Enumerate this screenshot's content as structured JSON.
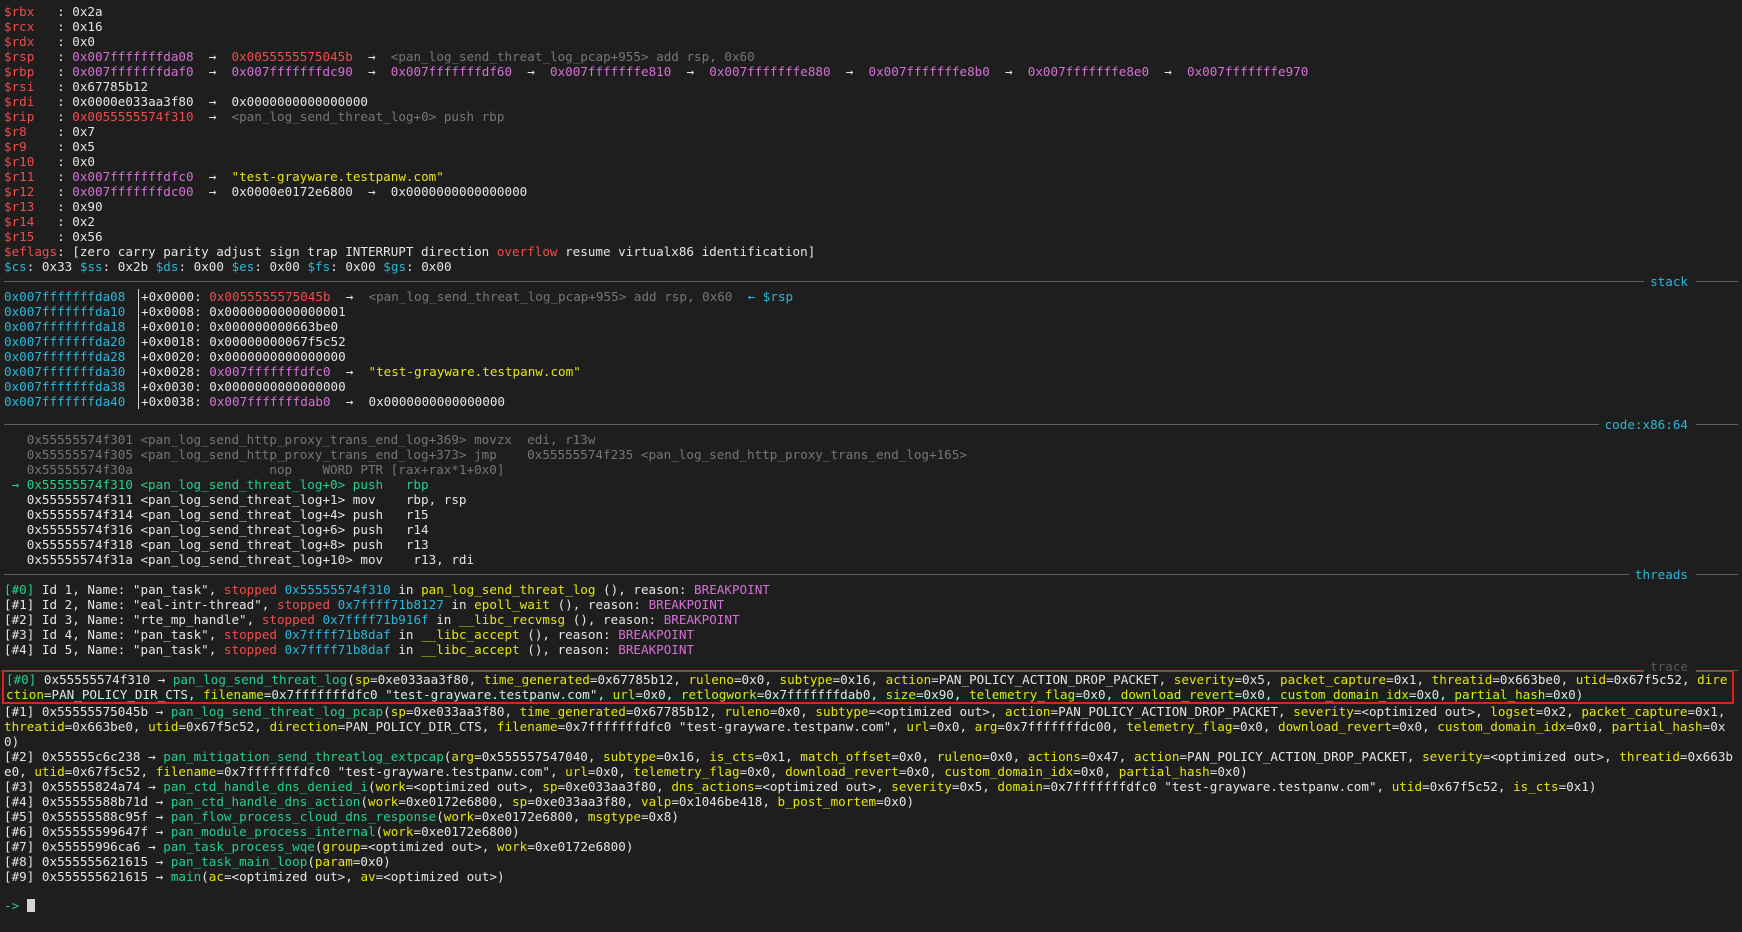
{
  "registers": [
    {
      "name": "$rbx",
      "pad": "   ",
      "parts": [
        [
          "wht",
          "0x2a"
        ]
      ]
    },
    {
      "name": "$rcx",
      "pad": "   ",
      "parts": [
        [
          "wht",
          "0x16"
        ]
      ]
    },
    {
      "name": "$rdx",
      "pad": "   ",
      "parts": [
        [
          "wht",
          "0x0"
        ]
      ]
    },
    {
      "name": "$rsp",
      "pad": "   ",
      "parts": [
        [
          "mag",
          "0x007fffffffda08"
        ],
        [
          "wht",
          "  →  "
        ],
        [
          "red",
          "0x0055555575045b"
        ],
        [
          "wht",
          "  →  "
        ],
        [
          "gry",
          "<pan_log_send_threat_log_pcap+955> add rsp, 0x60"
        ]
      ]
    },
    {
      "name": "$rbp",
      "pad": "   ",
      "parts": [
        [
          "mag",
          "0x007fffffffdaf0"
        ],
        [
          "wht",
          "  →  "
        ],
        [
          "mag",
          "0x007fffffffdc90"
        ],
        [
          "wht",
          "  →  "
        ],
        [
          "mag",
          "0x007fffffffdf60"
        ],
        [
          "wht",
          "  →  "
        ],
        [
          "mag",
          "0x007fffffffe810"
        ],
        [
          "wht",
          "  →  "
        ],
        [
          "mag",
          "0x007fffffffe880"
        ],
        [
          "wht",
          "  →  "
        ],
        [
          "mag",
          "0x007fffffffe8b0"
        ],
        [
          "wht",
          "  →  "
        ],
        [
          "mag",
          "0x007fffffffe8e0"
        ],
        [
          "wht",
          "  →  "
        ],
        [
          "mag",
          "0x007fffffffe970"
        ]
      ]
    },
    {
      "name": "$rsi",
      "pad": "   ",
      "parts": [
        [
          "wht",
          "0x67785b12"
        ]
      ]
    },
    {
      "name": "$rdi",
      "pad": "   ",
      "parts": [
        [
          "wht",
          "0x0000e033aa3f80"
        ],
        [
          "wht",
          "  →  "
        ],
        [
          "wht",
          "0x0000000000000000"
        ]
      ]
    },
    {
      "name": "$rip",
      "pad": "   ",
      "parts": [
        [
          "red",
          "0x0055555574f310"
        ],
        [
          "wht",
          "  →  "
        ],
        [
          "gry",
          "<pan_log_send_threat_log+0> push rbp"
        ]
      ]
    },
    {
      "name": "$r8",
      "pad": "    ",
      "parts": [
        [
          "wht",
          "0x7"
        ]
      ]
    },
    {
      "name": "$r9",
      "pad": "    ",
      "parts": [
        [
          "wht",
          "0x5"
        ]
      ]
    },
    {
      "name": "$r10",
      "pad": "   ",
      "parts": [
        [
          "wht",
          "0x0"
        ]
      ]
    },
    {
      "name": "$r11",
      "pad": "   ",
      "parts": [
        [
          "mag",
          "0x007fffffffdfc0"
        ],
        [
          "wht",
          "  →  "
        ],
        [
          "yel",
          "\"test-grayware.testpanw.com\""
        ]
      ]
    },
    {
      "name": "$r12",
      "pad": "   ",
      "parts": [
        [
          "mag",
          "0x007fffffffdc00"
        ],
        [
          "wht",
          "  →  "
        ],
        [
          "wht",
          "0x0000e0172e6800"
        ],
        [
          "wht",
          "  →  "
        ],
        [
          "wht",
          "0x0000000000000000"
        ]
      ]
    },
    {
      "name": "$r13",
      "pad": "   ",
      "parts": [
        [
          "wht",
          "0x90"
        ]
      ]
    },
    {
      "name": "$r14",
      "pad": "   ",
      "parts": [
        [
          "wht",
          "0x2"
        ]
      ]
    },
    {
      "name": "$r15",
      "pad": "   ",
      "parts": [
        [
          "wht",
          "0x56"
        ]
      ]
    }
  ],
  "eflags": {
    "label": "$eflags",
    "before": ": [zero carry parity adjust sign trap INTERRUPT direction ",
    "overflow": "overflow",
    "after": " resume virtualx86 identification]"
  },
  "segs": [
    {
      "n": "$cs",
      "v": "0x33"
    },
    {
      "n": "$ss",
      "v": "0x2b"
    },
    {
      "n": "$ds",
      "v": "0x00"
    },
    {
      "n": "$es",
      "v": "0x00"
    },
    {
      "n": "$fs",
      "v": "0x00"
    },
    {
      "n": "$gs",
      "v": "0x00"
    }
  ],
  "sections": {
    "stack": "stack",
    "code": "code:x86:64",
    "threads": "threads",
    "trace": "trace"
  },
  "stack": [
    {
      "addr": "0x007fffffffda08",
      "parts": [
        [
          "wht",
          "+0x0000: "
        ],
        [
          "red",
          "0x0055555575045b"
        ],
        [
          "wht",
          "  →  "
        ],
        [
          "gry",
          "<pan_log_send_threat_log_pcap+955> add rsp, 0x60"
        ],
        [
          "cyan",
          "  ← $rsp"
        ]
      ]
    },
    {
      "addr": "0x007fffffffda10",
      "parts": [
        [
          "wht",
          "+0x0008: 0x0000000000000001"
        ]
      ]
    },
    {
      "addr": "0x007fffffffda18",
      "parts": [
        [
          "wht",
          "+0x0010: 0x000000000663be0"
        ]
      ]
    },
    {
      "addr": "0x007fffffffda20",
      "parts": [
        [
          "wht",
          "+0x0018: 0x00000000067f5c52"
        ]
      ]
    },
    {
      "addr": "0x007fffffffda28",
      "parts": [
        [
          "wht",
          "+0x0020: 0x0000000000000000"
        ]
      ]
    },
    {
      "addr": "0x007fffffffda30",
      "parts": [
        [
          "wht",
          "+0x0028: "
        ],
        [
          "mag",
          "0x007fffffffdfc0"
        ],
        [
          "wht",
          "  →  "
        ],
        [
          "yel",
          "\"test-grayware.testpanw.com\""
        ]
      ]
    },
    {
      "addr": "0x007fffffffda38",
      "parts": [
        [
          "wht",
          "+0x0030: 0x0000000000000000"
        ]
      ]
    },
    {
      "addr": "0x007fffffffda40",
      "parts": [
        [
          "wht",
          "+0x0038: "
        ],
        [
          "mag",
          "0x007fffffffdab0"
        ],
        [
          "wht",
          "  →  "
        ],
        [
          "wht",
          "0x0000000000000000"
        ]
      ]
    }
  ],
  "code": [
    {
      "cls": "gry",
      "text": "   0x55555574f301 <pan_log_send_http_proxy_trans_end_log+369> movzx  edi, r13w"
    },
    {
      "cls": "gry",
      "text": "   0x55555574f305 <pan_log_send_http_proxy_trans_end_log+373> jmp    0x55555574f235 <pan_log_send_http_proxy_trans_end_log+165>"
    },
    {
      "cls": "gry",
      "text": "   0x55555574f30a                  nop    WORD PTR [rax+rax*1+0x0]"
    },
    {
      "cls": "grn",
      "text": " → 0x55555574f310 <pan_log_send_threat_log+0> push   rbp"
    },
    {
      "cls": "wht",
      "text": "   0x55555574f311 <pan_log_send_threat_log+1> mov    rbp, rsp"
    },
    {
      "cls": "wht",
      "text": "   0x55555574f314 <pan_log_send_threat_log+4> push   r15"
    },
    {
      "cls": "wht",
      "text": "   0x55555574f316 <pan_log_send_threat_log+6> push   r14"
    },
    {
      "cls": "wht",
      "text": "   0x55555574f318 <pan_log_send_threat_log+8> push   r13"
    },
    {
      "cls": "wht",
      "text": "   0x55555574f31a <pan_log_send_threat_log+10> mov    r13, rdi"
    }
  ],
  "threads": [
    {
      "idx": "[#0]",
      "id": " Id 1, Name: \"pan_task\", ",
      "addr": "0x55555574f310",
      "fn": "pan_log_send_threat_log",
      "first": true
    },
    {
      "idx": "[#1]",
      "id": " Id 2, Name: \"eal-intr-thread\", ",
      "addr": "0x7ffff71b8127",
      "fn": "epoll_wait"
    },
    {
      "idx": "[#2]",
      "id": " Id 3, Name: \"rte_mp_handle\", ",
      "addr": "0x7ffff71b916f",
      "fn": "__libc_recvmsg"
    },
    {
      "idx": "[#3]",
      "id": " Id 4, Name: \"pan_task\", ",
      "addr": "0x7ffff71b8daf",
      "fn": "__libc_accept"
    },
    {
      "idx": "[#4]",
      "id": " Id 5, Name: \"pan_task\", ",
      "addr": "0x7ffff71b8daf",
      "fn": "__libc_accept"
    }
  ],
  "thread_words": {
    "stopped": "stopped",
    "in": " in ",
    "tail": " (), reason: ",
    "reason": "BREAKPOINT"
  },
  "trace": [
    {
      "idx": "[#0]",
      "addr": " 0x55555574f310 → ",
      "fn": "pan_log_send_threat_log",
      "args": [
        [
          "sp",
          "=0xe033aa3f80"
        ],
        [
          "time_generated",
          "=0x67785b12"
        ],
        [
          "ruleno",
          "=0x0"
        ],
        [
          "subtype",
          "=0x16"
        ],
        [
          "action",
          "=PAN_POLICY_ACTION_DROP_PACKET"
        ],
        [
          "severity",
          "=0x5"
        ],
        [
          "packet_capture",
          "=0x1"
        ],
        [
          "threatid",
          "=0x663be0"
        ],
        [
          "utid",
          "=0x67f5c52"
        ],
        [
          "direction",
          "=PAN_POLICY_DIR_CTS"
        ],
        [
          "filename",
          "=0x7fffffffdfc0 \"test-grayware.testpanw.com\""
        ],
        [
          "url",
          "=0x0"
        ],
        [
          "retlogwork",
          "=0x7fffffffdab0"
        ],
        [
          "size",
          "=0x90"
        ],
        [
          "telemetry_flag",
          "=0x0"
        ],
        [
          "download_revert",
          "=0x0"
        ],
        [
          "custom_domain_idx",
          "=0x0"
        ],
        [
          "partial_hash",
          "=0x0"
        ]
      ]
    },
    {
      "idx": "[#1]",
      "addr": " 0x55555575045b → ",
      "fn": "pan_log_send_threat_log_pcap",
      "args": [
        [
          "sp",
          "=0xe033aa3f80"
        ],
        [
          "time_generated",
          "=0x67785b12"
        ],
        [
          "ruleno",
          "=0x0"
        ],
        [
          "subtype",
          "=<optimized out>"
        ],
        [
          "action",
          "=PAN_POLICY_ACTION_DROP_PACKET"
        ],
        [
          "severity",
          "=<optimized out>"
        ],
        [
          "logset",
          "=0x2"
        ],
        [
          "packet_capture",
          "=0x1"
        ],
        [
          "threatid",
          "=0x663be0"
        ],
        [
          "utid",
          "=0x67f5c52"
        ],
        [
          "direction",
          "=PAN_POLICY_DIR_CTS"
        ],
        [
          "filename",
          "=0x7fffffffdfc0 \"test-grayware.testpanw.com\""
        ],
        [
          "url",
          "=0x0"
        ],
        [
          "arg",
          "=0x7fffffffdc00"
        ],
        [
          "telemetry_flag",
          "=0x0"
        ],
        [
          "download_revert",
          "=0x0"
        ],
        [
          "custom_domain_idx",
          "=0x0"
        ],
        [
          "partial_hash",
          "=0x0"
        ]
      ]
    },
    {
      "idx": "[#2]",
      "addr": " 0x55555c6c238 → ",
      "fn": "pan_mitigation_send_threatlog_extpcap",
      "args": [
        [
          "arg",
          "=0x555557547040"
        ],
        [
          "subtype",
          "=0x16"
        ],
        [
          "is_cts",
          "=0x1"
        ],
        [
          "match_offset",
          "=0x0"
        ],
        [
          "ruleno",
          "=0x0"
        ],
        [
          "actions",
          "=0x47"
        ],
        [
          "action",
          "=PAN_POLICY_ACTION_DROP_PACKET"
        ],
        [
          "severity",
          "=<optimized out>"
        ],
        [
          "threatid",
          "=0x663be0"
        ],
        [
          "utid",
          "=0x67f5c52"
        ],
        [
          "filename",
          "=0x7fffffffdfc0 \"test-grayware.testpanw.com\""
        ],
        [
          "url",
          "=0x0"
        ],
        [
          "telemetry_flag",
          "=0x0"
        ],
        [
          "download_revert",
          "=0x0"
        ],
        [
          "custom_domain_idx",
          "=0x0"
        ],
        [
          "partial_hash",
          "=0x0"
        ]
      ]
    },
    {
      "idx": "[#3]",
      "addr": " 0x55555824a74 → ",
      "fn": "pan_ctd_handle_dns_denied_i",
      "args": [
        [
          "work",
          "=<optimized out>"
        ],
        [
          "sp",
          "=0xe033aa3f80"
        ],
        [
          "dns_actions",
          "=<optimized out>"
        ],
        [
          "severity",
          "=0x5"
        ],
        [
          "domain",
          "=0x7fffffffdfc0 \"test-grayware.testpanw.com\""
        ],
        [
          "utid",
          "=0x67f5c52"
        ],
        [
          "is_cts",
          "=0x1"
        ]
      ]
    },
    {
      "idx": "[#4]",
      "addr": " 0x55555588b71d → ",
      "fn": "pan_ctd_handle_dns_action",
      "args": [
        [
          "work",
          "=0xe0172e6800"
        ],
        [
          "sp",
          "=0xe033aa3f80"
        ],
        [
          "valp",
          "=0x1046be418"
        ],
        [
          "b_post_mortem",
          "=0x0"
        ]
      ]
    },
    {
      "idx": "[#5]",
      "addr": " 0x55555588c95f → ",
      "fn": "pan_flow_process_cloud_dns_response",
      "args": [
        [
          "work",
          "=0xe0172e6800"
        ],
        [
          "msgtype",
          "=0x8"
        ]
      ]
    },
    {
      "idx": "[#6]",
      "addr": " 0x55555599647f → ",
      "fn": "pan_module_process_internal",
      "args": [
        [
          "work",
          "=0xe0172e6800"
        ]
      ]
    },
    {
      "idx": "[#7]",
      "addr": " 0x55555996ca6 → ",
      "fn": "pan_task_process_wqe",
      "args": [
        [
          "group",
          "=<optimized out>"
        ],
        [
          "work",
          "=0xe0172e6800"
        ]
      ]
    },
    {
      "idx": "[#8]",
      "addr": " 0x555555621615 → ",
      "fn": "pan_task_main_loop",
      "args": [
        [
          "param",
          "=0x0"
        ]
      ]
    },
    {
      "idx": "[#9]",
      "addr": " 0x555555621615 → ",
      "fn": "main",
      "args": [
        [
          "ac",
          "=<optimized out>"
        ],
        [
          "av",
          "=<optimized out>"
        ]
      ]
    }
  ],
  "prompt": "-> "
}
